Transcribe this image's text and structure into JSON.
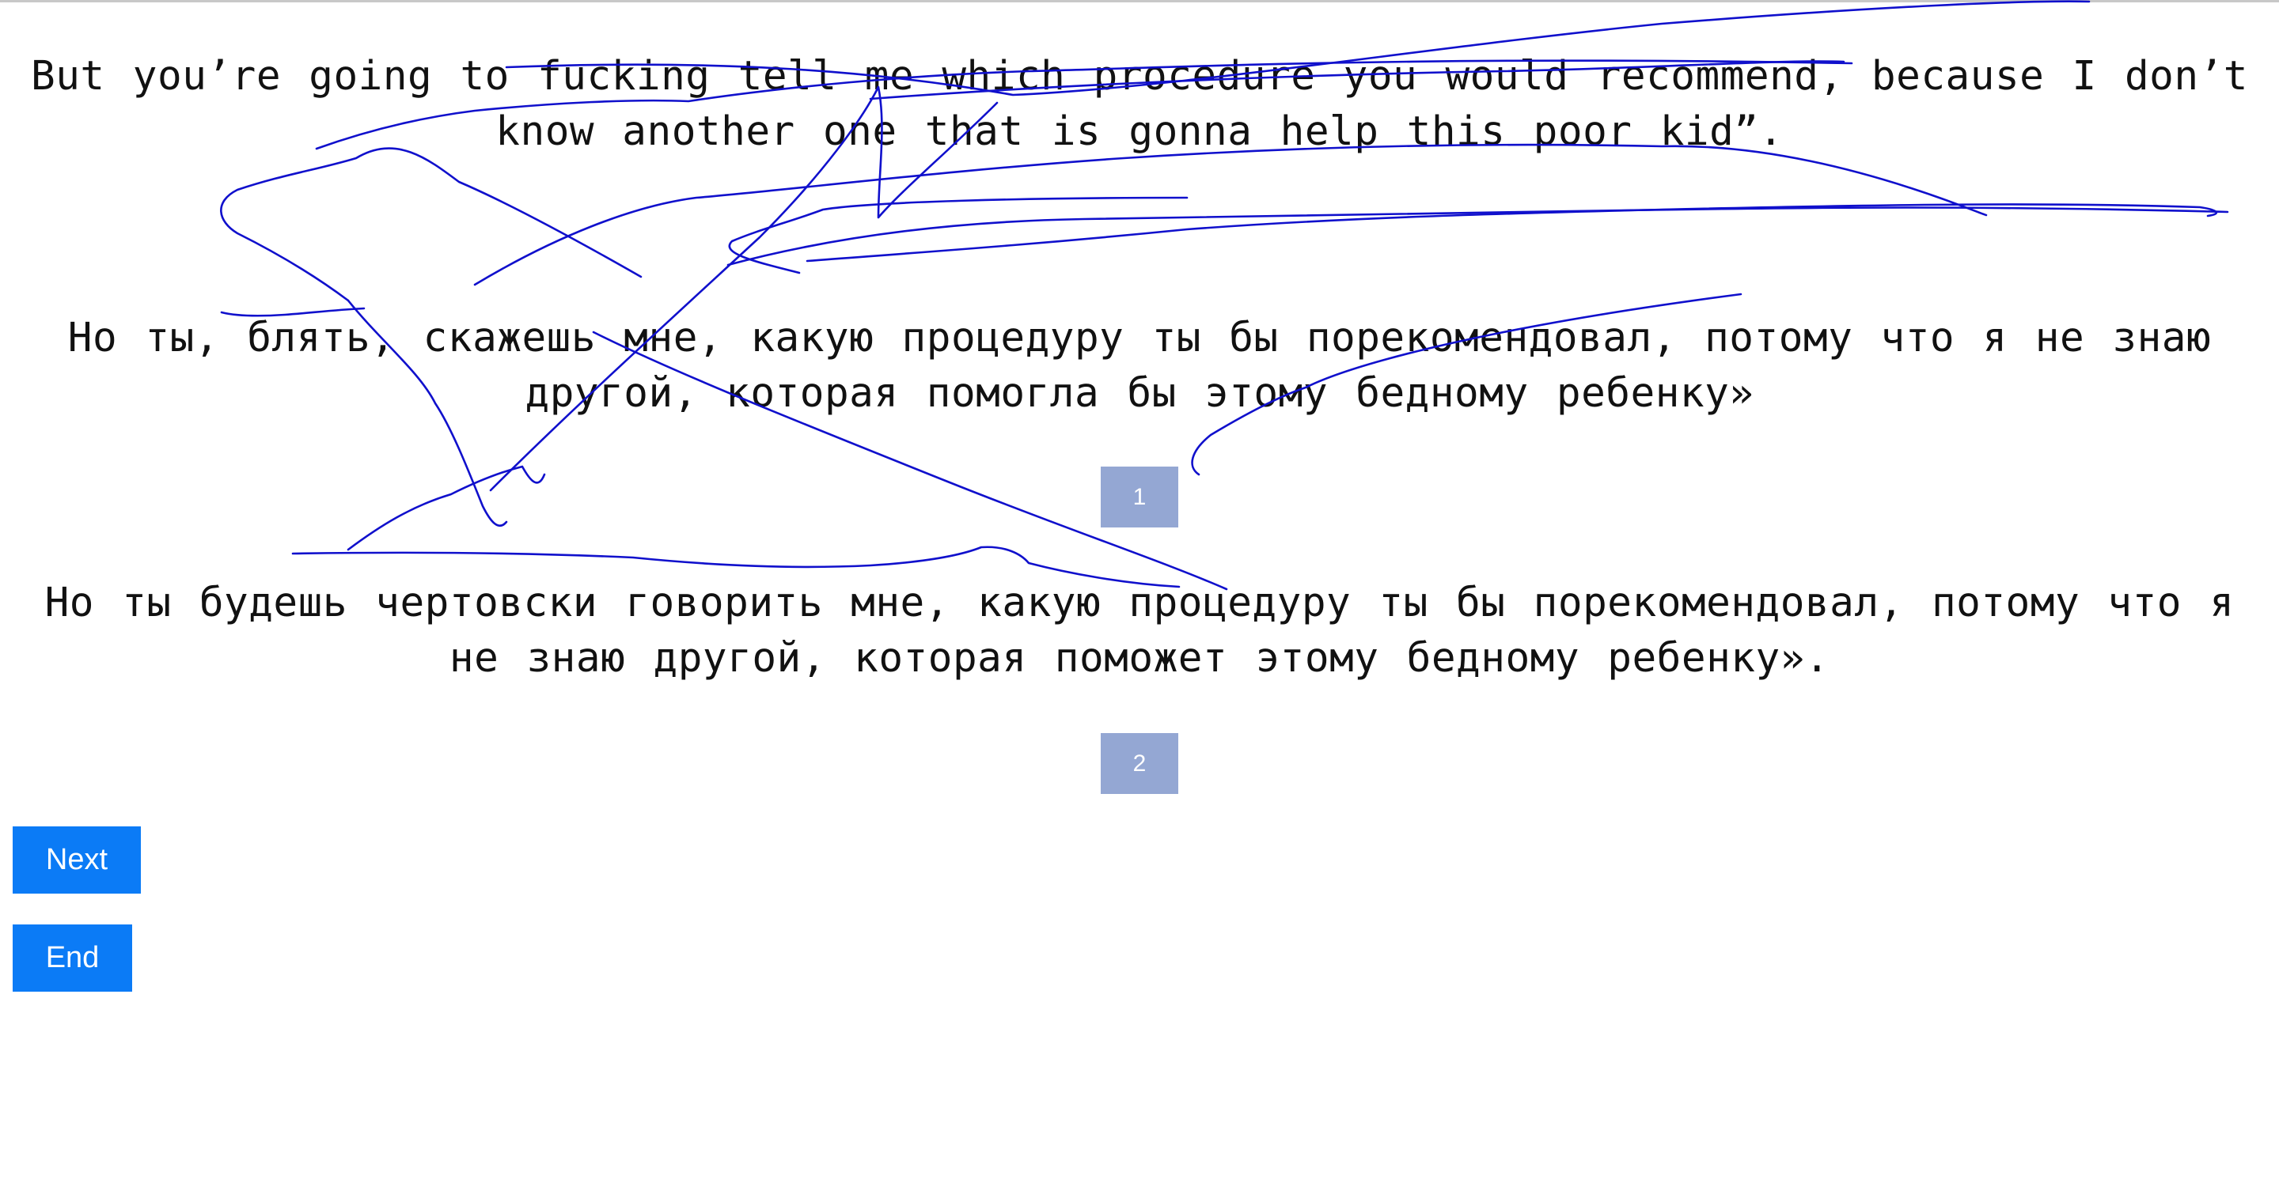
{
  "source": {
    "text": "But you’re going to fucking tell me which procedure you would recommend, because I don’t know another one that is gonna help this poor kid”."
  },
  "translations": [
    {
      "text": "Но ты, блять, скажешь мне, какую процедуру ты бы порекомендовал, потому что я не знаю другой, которая помогла бы этому бедному ребенку»",
      "choice_label": "1"
    },
    {
      "text": "Но ты будешь чертовски говорить мне, какую процедуру ты бы порекомендовал, потому что я не знаю другой, которая поможет этому бедному ребенку».",
      "choice_label": "2"
    }
  ],
  "buttons": {
    "next_label": "Next",
    "end_label": "End"
  },
  "colors": {
    "button_bg": "#0b7bf6",
    "choice_badge_bg": "#94a7d3",
    "scribble_stroke": "#1010cc"
  }
}
